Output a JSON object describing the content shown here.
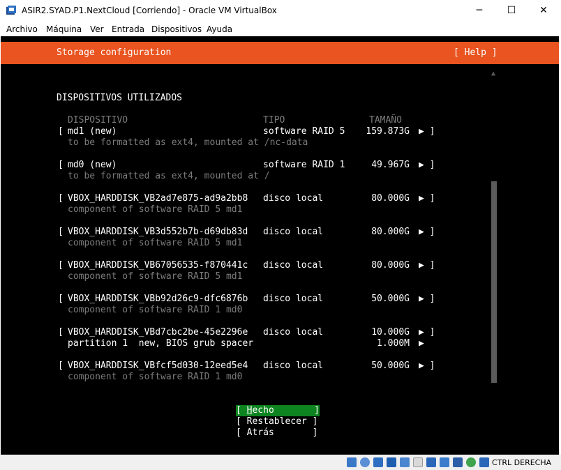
{
  "window": {
    "title": "ASIR2.SYAD.P1.NextCloud [Corriendo] - Oracle VM VirtualBox",
    "minimize": "─",
    "maximize": "☐",
    "close": "✕"
  },
  "menu": [
    "Archivo",
    "Máquina",
    "Ver",
    "Entrada",
    "Dispositivos",
    "Ayuda"
  ],
  "screen": {
    "header_title": "Storage configuration",
    "help": "[ Help ]",
    "section_title": "DISPOSITIVOS UTILIZADOS",
    "columns": {
      "device": "DISPOSITIVO",
      "type": "TIPO",
      "size": "TAMAÑO"
    },
    "rows": [
      {
        "open": "[",
        "name": "md1 (new)",
        "type": "software RAID 5",
        "size": "159.873G",
        "arrow": "▶ ]",
        "detail": "to be formatted as ext4, mounted at /nc-data"
      },
      {
        "open": "[",
        "name": "md0 (new)",
        "type": "software RAID 1",
        "size": "49.967G",
        "arrow": "▶ ]",
        "detail": "to be formatted as ext4, mounted at /"
      },
      {
        "open": "[",
        "name": "VBOX_HARDDISK_VB2ad7e875-ad9a2bb8",
        "type": "disco local",
        "size": "80.000G",
        "arrow": "▶ ]",
        "detail": "component of software RAID 5 md1"
      },
      {
        "open": "[",
        "name": "VBOX_HARDDISK_VB3d552b7b-d69db83d",
        "type": "disco local",
        "size": "80.000G",
        "arrow": "▶ ]",
        "detail": "component of software RAID 5 md1"
      },
      {
        "open": "[",
        "name": "VBOX_HARDDISK_VB67056535-f870441c",
        "type": "disco local",
        "size": "80.000G",
        "arrow": "▶ ]",
        "detail": "component of software RAID 5 md1"
      },
      {
        "open": "[",
        "name": "VBOX_HARDDISK_VBb92d26c9-dfc6876b",
        "type": "disco local",
        "size": "50.000G",
        "arrow": "▶ ]",
        "detail": "component of software RAID 1 md0"
      },
      {
        "open": "[",
        "name": "VBOX_HARDDISK_VBd7cbc2be-45e2296e",
        "type": "disco local",
        "size": "10.000G",
        "arrow": "▶ ]",
        "partition": {
          "name": "partition 1  new, BIOS grub spacer",
          "size": "1.000M",
          "arrow": "▶"
        }
      },
      {
        "open": "[",
        "name": "VBOX_HARDDISK_VBfcf5d030-12eed5e4",
        "type": "disco local",
        "size": "50.000G",
        "arrow": "▶ ]",
        "detail": "component of software RAID 1 md0"
      }
    ],
    "buttons": {
      "done_open": "[ ",
      "done_hotkey": "H",
      "done_rest": "echo",
      "done_close": "]",
      "reset": "[ Restablecer ]",
      "back": "[ Atrás       ]"
    },
    "scroll_up_arrow": "▲"
  },
  "status_bar": {
    "host_key": "CTRL DERECHA",
    "icons": [
      "hard-disk-icon",
      "optical-disk-icon",
      "audio-icon",
      "network-icon",
      "usb-icon",
      "shared-folders-icon",
      "display-icon",
      "video-capture-icon",
      "virtualization-icon",
      "mouse-integration-icon",
      "keyboard-icon"
    ]
  },
  "colors": {
    "header": "#e95420",
    "focus": "#0e8420",
    "dim_text": "#7c7c7c"
  }
}
